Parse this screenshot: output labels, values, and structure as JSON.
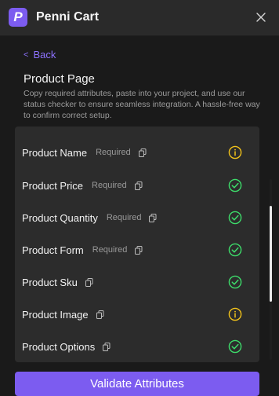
{
  "app": {
    "logo_letter": "P",
    "title": "Penni Cart"
  },
  "nav": {
    "back_label": "Back"
  },
  "page": {
    "title": "Product Page",
    "description": "Copy required attributes, paste into your project, and use our status checker to ensure seamless integration. A hassle-free way to confirm correct setup."
  },
  "attributes": [
    {
      "label": "Product Name",
      "required": "Required",
      "status": "warning"
    },
    {
      "label": "Product Price",
      "required": "Required",
      "status": "ok"
    },
    {
      "label": "Product Quantity",
      "required": "Required",
      "status": "ok"
    },
    {
      "label": "Product Form",
      "required": "Required",
      "status": "ok"
    },
    {
      "label": "Product Sku",
      "required": "",
      "status": "ok"
    },
    {
      "label": "Product Image",
      "required": "",
      "status": "warning"
    },
    {
      "label": "Product Options",
      "required": "",
      "status": "ok"
    }
  ],
  "actions": {
    "validate_label": "Validate Attributes"
  },
  "colors": {
    "accent": "#7c5cf0",
    "ok": "#3ddc6a",
    "warning": "#f2c21a"
  }
}
